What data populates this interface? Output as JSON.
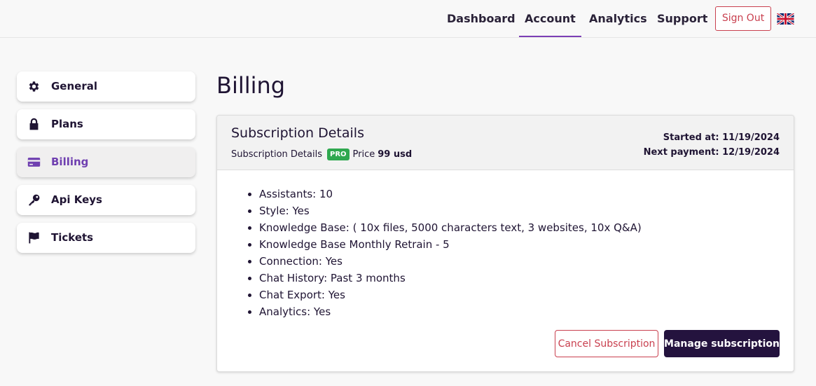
{
  "nav": {
    "items": [
      {
        "label": "Dashboard",
        "active": false
      },
      {
        "label": "Account",
        "active": true
      },
      {
        "label": "Analytics",
        "active": false
      },
      {
        "label": "Support",
        "active": false
      }
    ],
    "signout_label": "Sign Out",
    "language_icon": "uk-flag-icon"
  },
  "sidebar": {
    "items": [
      {
        "label": "General",
        "icon": "gear-icon",
        "active": false
      },
      {
        "label": "Plans",
        "icon": "lock-icon",
        "active": false
      },
      {
        "label": "Billing",
        "icon": "credit-card-icon",
        "active": true
      },
      {
        "label": "Api Keys",
        "icon": "key-icon",
        "active": false
      },
      {
        "label": "Tickets",
        "icon": "flag-icon",
        "active": false
      }
    ],
    "active_color": "#6f3fb0"
  },
  "page": {
    "title": "Billing"
  },
  "subscription": {
    "title": "Subscription Details",
    "sub_label": "Subscription Details",
    "plan_badge": "PRO",
    "price_label": "Price",
    "price_value": "99 usd",
    "started_at": "Started at: 11/19/2024",
    "next_payment": "Next payment: 12/19/2024",
    "features": [
      "Assistants: 10",
      "Style: Yes",
      "Knowledge Base: ( 10x files, 5000 characters text, 3 websites, 10x Q&A)",
      "Knowledge Base Monthly Retrain - 5",
      "Connection: Yes",
      "Chat History: Past 3 months",
      "Chat Export: Yes",
      "Analytics: Yes"
    ],
    "cancel_label": "Cancel Subscription",
    "manage_label": "Manage subscription"
  },
  "colors": {
    "accent": "#7b3fb5",
    "danger": "#c9404f",
    "primary_dark": "#24133e",
    "badge_green": "#2fa84f"
  }
}
